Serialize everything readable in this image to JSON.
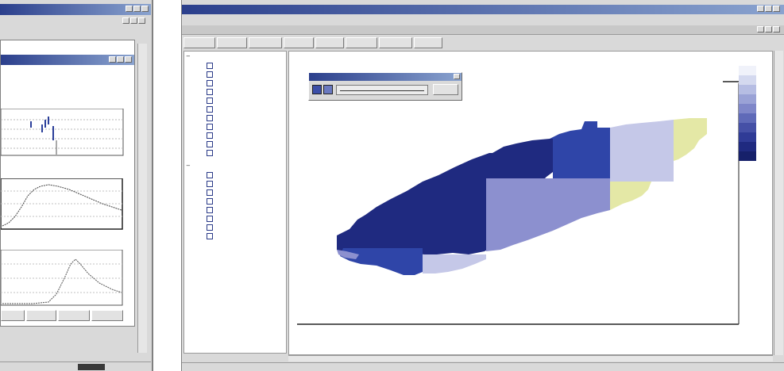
{
  "colors": {
    "title_bar_start": "#2b3f8c",
    "title_bar_end": "#8aa3cf",
    "panel_gray": "#d9d9d9",
    "legend_classes": [
      "#f0f2fa",
      "#d4d9ef",
      "#b6bde3",
      "#9aa2d6",
      "#7f87c9",
      "#5f6ab8",
      "#4550a6",
      "#2f3b96",
      "#1f2a80",
      "#16206a"
    ],
    "map_dark": "#1f2a80",
    "map_mid": "#2f45a8",
    "map_light_purple": "#8c90cf",
    "map_pale": "#c5c8e8",
    "map_yellow": "#e4e8a6"
  },
  "left_window": {
    "title": "",
    "menu_bar": "",
    "inner_window_title": "",
    "header_text": "",
    "charts": [
      {
        "title": "",
        "x_start": "",
        "x_end": ""
      },
      {
        "title": "",
        "x_start": "",
        "x_end": ""
      },
      {
        "title": "",
        "x_start": "",
        "x_end": ""
      }
    ],
    "tab_buttons": [
      "",
      "",
      "",
      ""
    ],
    "status_bar": {
      "left": "",
      "right": ""
    }
  },
  "main_window": {
    "title": "",
    "menu_bar": "",
    "inner_window_title": "",
    "toolbar_buttons": [
      "",
      "",
      "",
      "",
      "",
      "",
      "",
      ""
    ],
    "tree": {
      "group_1": {
        "label": "",
        "items": [
          {
            "label": ""
          },
          {
            "label": ""
          },
          {
            "label": ""
          },
          {
            "label": ""
          },
          {
            "label": ""
          },
          {
            "label": ""
          },
          {
            "label": ""
          },
          {
            "label": ""
          },
          {
            "label": ""
          },
          {
            "label": ""
          },
          {
            "label": ""
          }
        ]
      },
      "group_2": {
        "label": "",
        "items": [
          {
            "label": ""
          },
          {
            "label": ""
          },
          {
            "label": ""
          },
          {
            "label": ""
          },
          {
            "label": ""
          },
          {
            "label": ""
          },
          {
            "label": ""
          },
          {
            "label": ""
          }
        ]
      }
    },
    "map": {
      "header_left_line1": "",
      "header_left_line2": "",
      "header_center": "",
      "slider_popup": {
        "title": "",
        "value_text": "",
        "button": ""
      },
      "legend_labels": [
        "",
        "",
        "",
        "",
        "",
        "",
        "",
        "",
        "",
        ""
      ]
    },
    "status_bar": {
      "left": "",
      "right": ""
    }
  }
}
